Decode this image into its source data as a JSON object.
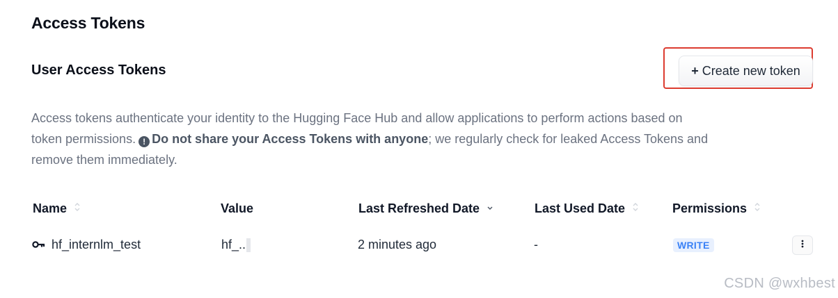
{
  "page_title": "Access Tokens",
  "section_title": "User Access Tokens",
  "create_button": {
    "plus": "+",
    "label": "Create new token"
  },
  "description": {
    "line1": "Access tokens authenticate your identity to the Hugging Face Hub and allow applications to perform actions based on",
    "line2_start": "token permissions.",
    "warn_icon_glyph": "!",
    "bold_1": "Do not share your ",
    "bold_2": "Access Tokens",
    "bold_3": " with anyone",
    "line2_end": "; we regularly check for leaked Access Tokens and",
    "line3": "remove them immediately."
  },
  "table": {
    "columns": [
      "Name",
      "Value",
      "Last Refreshed Date",
      "Last Used Date",
      "Permissions"
    ],
    "rows": [
      {
        "name": "hf_internlm_test",
        "value": "hf_..",
        "last_refreshed": "2 minutes ago",
        "last_used": "-",
        "permission": "WRITE"
      }
    ]
  },
  "icons": {
    "key": "key-icon",
    "sort": "sort-icon",
    "menu": "dots-vertical-icon",
    "warning": "exclamation-circle-icon"
  },
  "colors": {
    "highlight": "#dc3b2f",
    "badge_bg": "#e8f0fe",
    "badge_text": "#3b82f6",
    "muted_text": "#6b7280"
  },
  "watermark": "CSDN @wxhbest"
}
